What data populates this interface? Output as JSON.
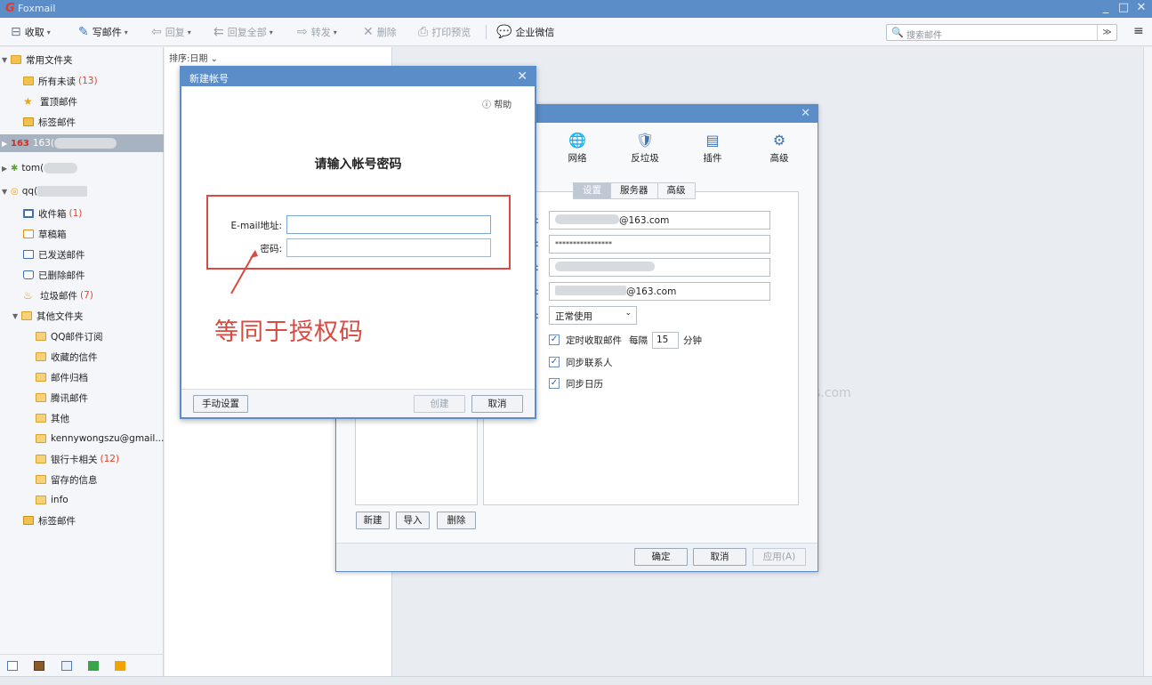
{
  "app": {
    "title": "Foxmail",
    "logo": "G"
  },
  "window_controls": {
    "minimize": "_",
    "maximize": "□",
    "close": "✕"
  },
  "toolbar": {
    "receive": "收取",
    "compose": "写邮件",
    "reply": "回复",
    "reply_all": "回复全部",
    "forward": "转发",
    "delete": "删除",
    "print_preview": "打印预览",
    "wecom": "企业微信",
    "search_placeholder": "搜索邮件",
    "dropdown_arrow": "▾",
    "search_options": "≫",
    "menu": "≡"
  },
  "sidebar": {
    "common_folders": "常用文件夹",
    "all_unread": {
      "label": "所有未读",
      "count": "(13)"
    },
    "pinned": "置顶邮件",
    "tagged": "标签邮件",
    "acc163": {
      "badge": "163",
      "label": "163("
    },
    "acctom": {
      "label": "tom("
    },
    "accqq": {
      "label": "qq("
    },
    "inbox": {
      "label": "收件箱",
      "count": "(1)"
    },
    "drafts": "草稿箱",
    "sent": "已发送邮件",
    "deleted": "已删除邮件",
    "spam": {
      "label": "垃圾邮件",
      "count": "(7)"
    },
    "other_folders": "其他文件夹",
    "sub": {
      "qq_sub": "QQ邮件订阅",
      "favorites": "收藏的信件",
      "archive": "邮件归档",
      "tencent": "腾讯邮件",
      "other": "其他",
      "gmail": "kennywongszu@gmail....",
      "bank": {
        "label": "银行卡相关",
        "count": "(12)"
      },
      "saved": "留存的信息",
      "info": "info"
    },
    "tagged2": "标签邮件"
  },
  "list": {
    "sort_label": "排序:日期",
    "sort_arrow": "⌄"
  },
  "watermark": "s.com",
  "settings_dialog": {
    "categories": [
      {
        "label": "网络",
        "icon": "🌐"
      },
      {
        "label": "反垃圾",
        "icon": "🛡"
      },
      {
        "label": "插件",
        "icon": "▤"
      },
      {
        "label": "高级",
        "icon": "⚙"
      }
    ],
    "tabs": [
      "设置",
      "服务器",
      "高级"
    ],
    "email": "@163.com",
    "password": "****************",
    "reply_email": "@163.com",
    "status": "正常使用",
    "auto_receive": "定时收取邮件",
    "every": "每隔",
    "interval": "15",
    "minutes": "分钟",
    "sync_contacts": "同步联系人",
    "sync_calendar": "同步日历",
    "btn_new": "新建",
    "btn_import": "导入",
    "btn_delete": "删除",
    "btn_ok": "确定",
    "btn_cancel": "取消",
    "btn_apply": "应用(A)"
  },
  "new_account_dialog": {
    "title": "新建帐号",
    "help": "帮助",
    "heading": "请输入帐号密码",
    "email_label": "E-mail地址:",
    "password_label": "密码:",
    "email_value": "",
    "password_value": "",
    "btn_manual": "手动设置",
    "btn_create": "创建",
    "btn_cancel": "取消"
  },
  "annotation": {
    "text": "等同于授权码",
    "color": "#d94a41"
  }
}
